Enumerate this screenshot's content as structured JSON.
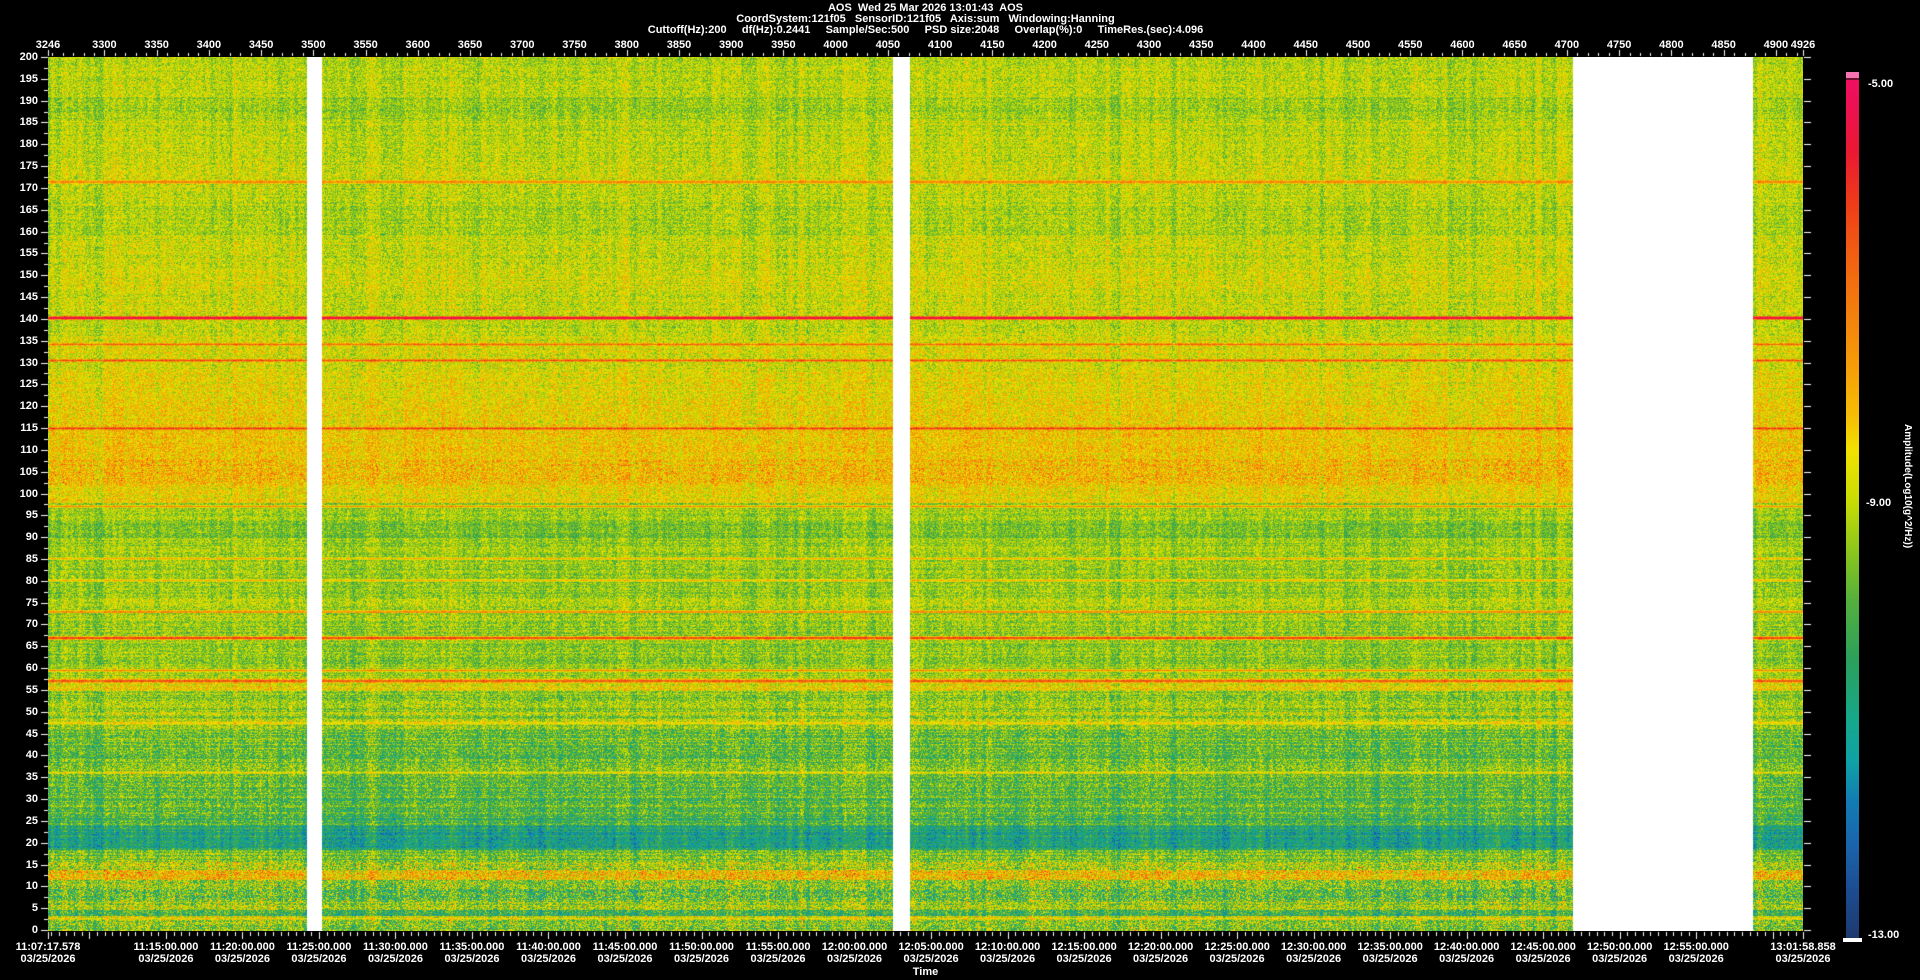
{
  "window": {
    "background": "#000000",
    "text_color": "#ffffff"
  },
  "header": {
    "line1": "AOS  Wed 25 Mar 2026 13:01:43  AOS",
    "line2": "CoordSystem:121f05   SensorID:121f05   Axis:sum   Windowing:Hanning",
    "line3": "Cuttoff(Hz):200     df(Hz):0.2441     Sample/Sec:500     PSD size:2048     Overlap(%):0     TimeRes.(sec):4.096"
  },
  "colorbar": {
    "tick_labels": [
      "-5.00",
      "-9.00",
      "-13.00"
    ],
    "title": "Amplitude(Log10(g^2/Hz))",
    "cap_color": "#f473b0",
    "cap_divider_color": "#701030",
    "underline_color": "#ffffff"
  },
  "chart_data": {
    "type": "heatmap",
    "subtype": "spectrogram",
    "xlabel": "Time",
    "record_axis": {
      "min": 3246,
      "max": 4926,
      "minor_step": 10,
      "labels": [
        3246,
        3300,
        3350,
        3400,
        3450,
        3500,
        3550,
        3600,
        3650,
        3700,
        3750,
        3800,
        3850,
        3900,
        3950,
        4000,
        4050,
        4100,
        4150,
        4200,
        4250,
        4300,
        4350,
        4400,
        4450,
        4500,
        4550,
        4600,
        4650,
        4700,
        4750,
        4800,
        4850,
        4900,
        4926
      ]
    },
    "y_axis": {
      "unit": "Hz",
      "min": 0,
      "max": 200,
      "label_step": 5,
      "minor_step": 2.5,
      "labels": [
        200,
        195,
        190,
        185,
        180,
        175,
        170,
        165,
        160,
        155,
        150,
        145,
        140,
        135,
        130,
        125,
        120,
        115,
        110,
        105,
        100,
        95,
        90,
        85,
        80,
        75,
        70,
        65,
        60,
        55,
        50,
        45,
        40,
        35,
        30,
        25,
        20,
        15,
        10,
        5,
        0
      ]
    },
    "z_axis": {
      "min": -13.0,
      "max": -5.0,
      "mid": -9.0
    },
    "time_axis": {
      "start_time": "11:07:17.578",
      "start_date": "03/25/2026",
      "end_time": "13:01:58.858",
      "end_date": "03/25/2026",
      "total_seconds": 6881.28,
      "major_tick_seconds": 300,
      "minor_tick_seconds": 30,
      "first_major_offset_seconds": 162.422,
      "first_minor_offset_seconds": 12.422,
      "labels": [
        {
          "time": "11:07:17.578",
          "date": "03/25/2026",
          "seconds": 0
        },
        {
          "time": "11:15:00.000",
          "date": "03/25/2026",
          "seconds": 462.422
        },
        {
          "time": "11:20:00.000",
          "date": "03/25/2026",
          "seconds": 762.422
        },
        {
          "time": "11:25:00.000",
          "date": "03/25/2026",
          "seconds": 1062.422
        },
        {
          "time": "11:30:00.000",
          "date": "03/25/2026",
          "seconds": 1362.422
        },
        {
          "time": "11:35:00.000",
          "date": "03/25/2026",
          "seconds": 1662.422
        },
        {
          "time": "11:40:00.000",
          "date": "03/25/2026",
          "seconds": 1962.422
        },
        {
          "time": "11:45:00.000",
          "date": "03/25/2026",
          "seconds": 2262.422
        },
        {
          "time": "11:50:00.000",
          "date": "03/25/2026",
          "seconds": 2562.422
        },
        {
          "time": "11:55:00.000",
          "date": "03/25/2026",
          "seconds": 2862.422
        },
        {
          "time": "12:00:00.000",
          "date": "03/25/2026",
          "seconds": 3162.422
        },
        {
          "time": "12:05:00.000",
          "date": "03/25/2026",
          "seconds": 3462.422
        },
        {
          "time": "12:10:00.000",
          "date": "03/25/2026",
          "seconds": 3762.422
        },
        {
          "time": "12:15:00.000",
          "date": "03/25/2026",
          "seconds": 4062.422
        },
        {
          "time": "12:20:00.000",
          "date": "03/25/2026",
          "seconds": 4362.422
        },
        {
          "time": "12:25:00.000",
          "date": "03/25/2026",
          "seconds": 4662.422
        },
        {
          "time": "12:30:00.000",
          "date": "03/25/2026",
          "seconds": 4962.422
        },
        {
          "time": "12:35:00.000",
          "date": "03/25/2026",
          "seconds": 5262.422
        },
        {
          "time": "12:40:00.000",
          "date": "03/25/2026",
          "seconds": 5562.422
        },
        {
          "time": "12:45:00.000",
          "date": "03/25/2026",
          "seconds": 5862.422
        },
        {
          "time": "12:50:00.000",
          "date": "03/25/2026",
          "seconds": 6162.422
        },
        {
          "time": "12:55:00.000",
          "date": "03/25/2026",
          "seconds": 6462.422
        },
        {
          "time": "13:01:58.858",
          "date": "03/25/2026",
          "seconds": 6881.28
        }
      ]
    },
    "palette": [
      [
        0.0,
        "#1d3a70"
      ],
      [
        0.055,
        "#1c4c90"
      ],
      [
        0.113,
        "#1966ae"
      ],
      [
        0.16,
        "#127cb2"
      ],
      [
        0.206,
        "#0fa2a6"
      ],
      [
        0.253,
        "#16a88c"
      ],
      [
        0.323,
        "#2aa05c"
      ],
      [
        0.393,
        "#54b03c"
      ],
      [
        0.451,
        "#8cc61c"
      ],
      [
        0.509,
        "#c8dc04"
      ],
      [
        0.568,
        "#f2e200"
      ],
      [
        0.61,
        "#f6bc04"
      ],
      [
        0.672,
        "#f59a08"
      ],
      [
        0.742,
        "#f2790e"
      ],
      [
        0.801,
        "#f15c12"
      ],
      [
        0.859,
        "#ee3a1a"
      ],
      [
        0.917,
        "#ea1832"
      ],
      [
        0.976,
        "#ed1056"
      ],
      [
        1.0,
        "#ee1060"
      ]
    ],
    "bands": [
      [
        200,
        191,
        0.5,
        0.095,
        0.025,
        0.02,
        0
      ],
      [
        191,
        186,
        0.465,
        0.095,
        0.025,
        0.02,
        0
      ],
      [
        186,
        176,
        0.5,
        0.095,
        0.025,
        0.02,
        0
      ],
      [
        176,
        172,
        0.515,
        0.1,
        0.025,
        0.02,
        0
      ],
      [
        172,
        166,
        0.5,
        0.095,
        0.025,
        0.02,
        0
      ],
      [
        166,
        159,
        0.48,
        0.095,
        0.025,
        0.02,
        0
      ],
      [
        159,
        152,
        0.51,
        0.1,
        0.025,
        0.02,
        0
      ],
      [
        152,
        146,
        0.53,
        0.1,
        0.025,
        0.02,
        0
      ],
      [
        146,
        136,
        0.51,
        0.1,
        0.025,
        0.02,
        0
      ],
      [
        136,
        128,
        0.53,
        0.105,
        0.025,
        0.02,
        0
      ],
      [
        128,
        122,
        0.555,
        0.105,
        0.03,
        0.02,
        0
      ],
      [
        122,
        116,
        0.575,
        0.11,
        0.03,
        0.02,
        0
      ],
      [
        116,
        108,
        0.595,
        0.115,
        0.03,
        0.02,
        0
      ],
      [
        108,
        102,
        0.62,
        0.13,
        0.035,
        0.02,
        0.004
      ],
      [
        102,
        98,
        0.56,
        0.11,
        0.03,
        0.02,
        0
      ],
      [
        98,
        94,
        0.465,
        0.095,
        0.025,
        0.025,
        0
      ],
      [
        94,
        90,
        0.425,
        0.09,
        0.025,
        0.025,
        0
      ],
      [
        90,
        84,
        0.47,
        0.095,
        0.03,
        0.03,
        0
      ],
      [
        84,
        77,
        0.455,
        0.095,
        0.03,
        0.03,
        0
      ],
      [
        77,
        70,
        0.47,
        0.1,
        0.035,
        0.03,
        0
      ],
      [
        70,
        61,
        0.455,
        0.1,
        0.035,
        0.035,
        0
      ],
      [
        61,
        57.8,
        0.465,
        0.1,
        0.035,
        0.035,
        0
      ],
      [
        57.8,
        54.8,
        0.56,
        0.12,
        0.04,
        0.04,
        0
      ],
      [
        54.8,
        50,
        0.445,
        0.115,
        0.045,
        0.055,
        0
      ],
      [
        50,
        46,
        0.465,
        0.12,
        0.05,
        0.055,
        0
      ],
      [
        46,
        40,
        0.42,
        0.125,
        0.05,
        0.07,
        0
      ],
      [
        40,
        34,
        0.41,
        0.125,
        0.05,
        0.075,
        0
      ],
      [
        34,
        28,
        0.39,
        0.13,
        0.05,
        0.085,
        0
      ],
      [
        28,
        24,
        0.37,
        0.13,
        0.05,
        0.09,
        0
      ],
      [
        24,
        18.5,
        0.275,
        0.12,
        0.045,
        0.13,
        0
      ],
      [
        18.5,
        16,
        0.41,
        0.13,
        0.05,
        0.1,
        0
      ],
      [
        16,
        13.8,
        0.465,
        0.15,
        0.05,
        0.1,
        0.006
      ],
      [
        13.8,
        11.6,
        0.615,
        0.16,
        0.05,
        0.1,
        0.012
      ],
      [
        11.6,
        9.5,
        0.43,
        0.16,
        0.05,
        0.12,
        0.003
      ],
      [
        9.5,
        6.5,
        0.4,
        0.17,
        0.05,
        0.14,
        0.004
      ],
      [
        6.5,
        4.6,
        0.465,
        0.145,
        0.045,
        0.1,
        0
      ],
      [
        4.6,
        3.4,
        0.365,
        0.15,
        0.045,
        0.12,
        0
      ],
      [
        3.4,
        2.4,
        0.51,
        0.15,
        0.045,
        0.1,
        0
      ],
      [
        2.4,
        0,
        0.425,
        0.16,
        0.045,
        0.12,
        0.003
      ]
    ],
    "tonal_lines": [
      [
        171.5,
        0.7,
        0.9
      ],
      [
        140.3,
        0.95,
        1.0
      ],
      [
        134.2,
        0.78,
        0.7
      ],
      [
        130.6,
        0.82,
        0.9
      ],
      [
        115.0,
        0.86,
        0.9
      ],
      [
        97.2,
        0.7,
        0.7
      ],
      [
        85.3,
        0.63,
        0.6
      ],
      [
        80.2,
        0.62,
        0.6
      ],
      [
        73.0,
        0.68,
        0.7
      ],
      [
        67.0,
        0.82,
        1.1
      ],
      [
        59.6,
        0.71,
        0.7
      ],
      [
        57.2,
        0.79,
        0.9
      ],
      [
        47.5,
        0.58,
        0.7
      ],
      [
        36.2,
        0.56,
        0.7
      ],
      [
        2.8,
        0.58,
        0.7
      ]
    ],
    "data_gaps": [
      [
        0.1476,
        0.1561
      ],
      [
        0.4815,
        0.4912
      ],
      [
        0.8689,
        0.9715
      ]
    ],
    "gap_color": "#ffffff"
  }
}
